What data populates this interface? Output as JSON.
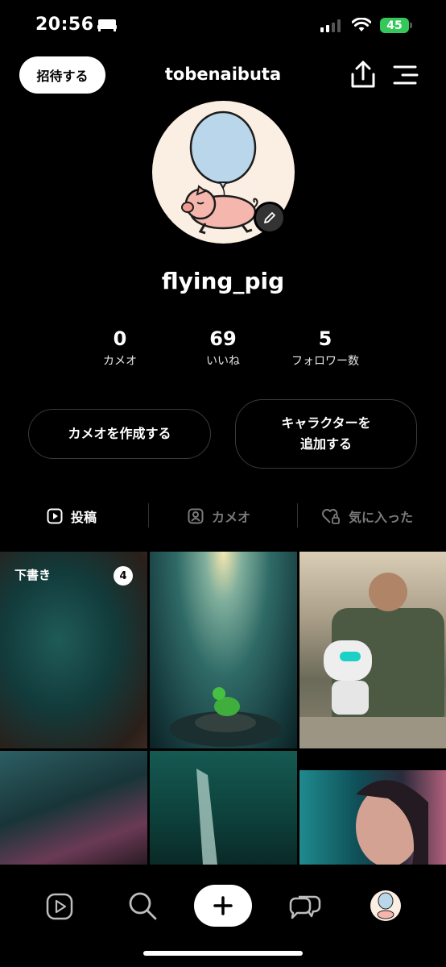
{
  "status_bar": {
    "time": "20:56",
    "battery": "45"
  },
  "header": {
    "invite_label": "招待する",
    "username": "tobenaibuta"
  },
  "profile": {
    "display_name": "flying_pig"
  },
  "stats": [
    {
      "value": "0",
      "label": "カメオ"
    },
    {
      "value": "69",
      "label": "いいね"
    },
    {
      "value": "5",
      "label": "フォロワー数"
    }
  ],
  "actions": {
    "create_cameo": "カメオを作成する",
    "add_character_line1": "キャラクターを",
    "add_character_line2": "追加する"
  },
  "tabs": [
    {
      "label": "投稿",
      "icon": "play-square-icon",
      "active": true
    },
    {
      "label": "カメオ",
      "icon": "person-square-icon",
      "active": false
    },
    {
      "label": "気に入った",
      "icon": "heart-lock-icon",
      "active": false
    }
  ],
  "grid": {
    "draft_label": "下書き",
    "draft_count": "4",
    "tiles": [
      "drafts-blurred-teal",
      "frog-in-well",
      "robot-and-man",
      "hooded-person",
      "crystal-shard",
      "woman-teal-light"
    ]
  },
  "bottom_nav": [
    "feed-play-icon",
    "search-icon",
    "create-plus-icon",
    "chat-bubbles-icon",
    "profile-avatar"
  ],
  "colors": {
    "background": "#000000",
    "battery": "#34c759",
    "tab_inactive": "#7a7a7a"
  }
}
